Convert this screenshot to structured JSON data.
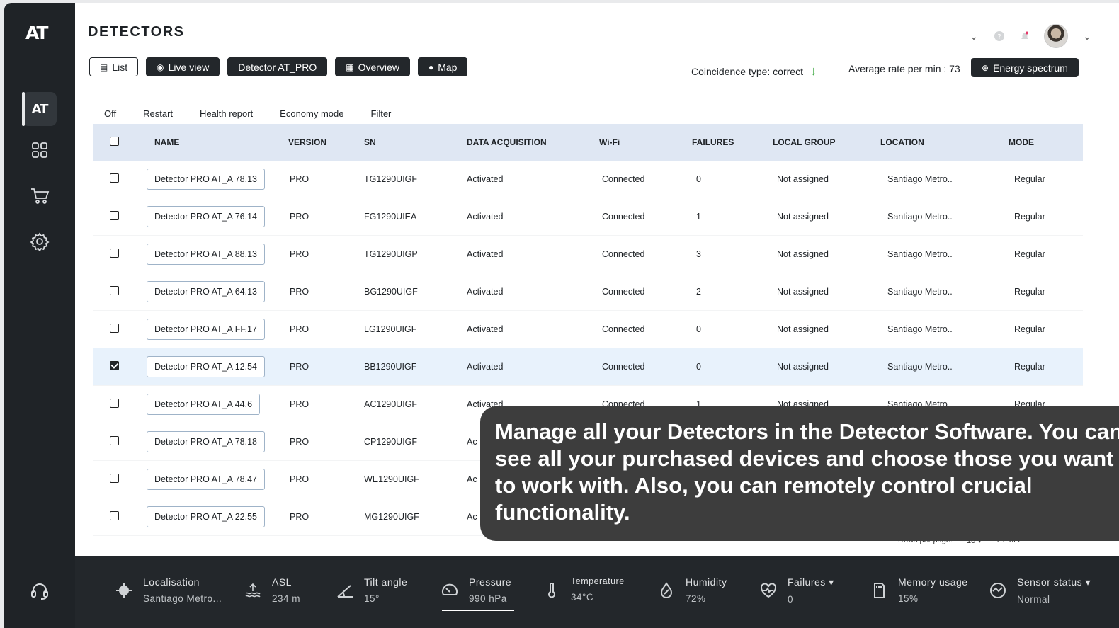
{
  "app": {
    "logo": "AT",
    "title": "DETECTORS"
  },
  "sidebar": {
    "items": [
      {
        "name": "home",
        "icon": "at-logo-icon"
      },
      {
        "name": "dashboard",
        "icon": "grid-icon"
      },
      {
        "name": "shop",
        "icon": "cart-icon"
      },
      {
        "name": "settings",
        "icon": "gear-icon"
      },
      {
        "name": "support",
        "icon": "headset-icon"
      }
    ]
  },
  "toolbar": {
    "list": "List",
    "live_view": "Live view",
    "detector": "Detector AT_PRO",
    "overview": "Overview",
    "map": "Map"
  },
  "header": {
    "coincidence": "Coincidence type: correct",
    "average_rate": "Average rate per min : 73",
    "energy_spectrum": "Energy spectrum"
  },
  "actions": [
    "Off",
    "Restart",
    "Health report",
    "Economy mode",
    "Filter"
  ],
  "table": {
    "columns": [
      "NAME",
      "VERSION",
      "SN",
      "DATA ACQUISITION",
      "Wi-Fi",
      "FAILURES",
      "LOCAL GROUP",
      "LOCATION",
      "MODE"
    ],
    "rows": [
      {
        "checked": false,
        "name": "Detector PRO AT_A 78.13",
        "version": "PRO",
        "sn": "TG1290UIGF",
        "da": "Activated",
        "wifi": "Connected",
        "failures": "0",
        "group": "Not assigned",
        "location": "Santiago Metro..",
        "mode": "Regular"
      },
      {
        "checked": false,
        "name": "Detector PRO AT_A 76.14",
        "version": "PRO",
        "sn": "FG1290UIEA",
        "da": "Activated",
        "wifi": "Connected",
        "failures": "1",
        "group": "Not assigned",
        "location": "Santiago Metro..",
        "mode": "Regular"
      },
      {
        "checked": false,
        "name": "Detector PRO AT_A 88.13",
        "version": "PRO",
        "sn": "TG1290UIGP",
        "da": "Activated",
        "wifi": "Connected",
        "failures": "3",
        "group": "Not assigned",
        "location": "Santiago Metro..",
        "mode": "Regular"
      },
      {
        "checked": false,
        "name": "Detector PRO AT_A 64.13",
        "version": "PRO",
        "sn": "BG1290UIGF",
        "da": "Activated",
        "wifi": "Connected",
        "failures": "2",
        "group": "Not assigned",
        "location": "Santiago Metro..",
        "mode": "Regular"
      },
      {
        "checked": false,
        "name": "Detector PRO AT_A FF.17",
        "version": "PRO",
        "sn": "LG1290UIGF",
        "da": "Activated",
        "wifi": "Connected",
        "failures": "0",
        "group": "Not assigned",
        "location": "Santiago Metro..",
        "mode": "Regular"
      },
      {
        "checked": true,
        "name": "Detector PRO AT_A 12.54",
        "version": "PRO",
        "sn": "BB1290UIGF",
        "da": "Activated",
        "wifi": "Connected",
        "failures": "0",
        "group": "Not assigned",
        "location": "Santiago Metro..",
        "mode": "Regular"
      },
      {
        "checked": false,
        "name": "Detector PRO AT_A 44.6",
        "version": "PRO",
        "sn": "AC1290UIGF",
        "da": "Activated",
        "wifi": "Connected",
        "failures": "1",
        "group": "Not assigned",
        "location": "Santiago Metro..",
        "mode": "Regular"
      },
      {
        "checked": false,
        "name": "Detector PRO AT_A 78.18",
        "version": "PRO",
        "sn": "CP1290UIGF",
        "da": "Ac",
        "wifi": "",
        "failures": "",
        "group": "",
        "location": "",
        "mode": ""
      },
      {
        "checked": false,
        "name": "Detector PRO AT_A 78.47",
        "version": "PRO",
        "sn": "WE1290UIGF",
        "da": "Ac",
        "wifi": "",
        "failures": "",
        "group": "",
        "location": "",
        "mode": ""
      },
      {
        "checked": false,
        "name": "Detector PRO AT_A 22.55",
        "version": "PRO",
        "sn": "MG1290UIGF",
        "da": "Ac",
        "wifi": "",
        "failures": "",
        "group": "",
        "location": "",
        "mode": ""
      }
    ]
  },
  "pager": {
    "rows_label": "Rows per page:",
    "rows_value": "10",
    "range": "1-2 of 2"
  },
  "bottom": {
    "stats": [
      {
        "label": "Localisation",
        "value": "Santiago Metro...",
        "icon": "location-target-icon"
      },
      {
        "label": "ASL",
        "value": "234 m",
        "icon": "altitude-icon"
      },
      {
        "label": "Tilt angle",
        "value": "15°",
        "icon": "angle-icon"
      },
      {
        "label": "Pressure",
        "value": "990 hPa",
        "icon": "gauge-icon"
      },
      {
        "label": "Temperature",
        "value": "34°C",
        "icon": "thermometer-icon"
      },
      {
        "label": "Humidity",
        "value": "72%",
        "icon": "droplet-icon"
      },
      {
        "label": "Failures ▾",
        "value": "0",
        "icon": "heart-pulse-icon"
      },
      {
        "label": "Memory usage",
        "value": "15%",
        "icon": "sd-card-icon"
      },
      {
        "label": "Sensor status ▾",
        "value": "Normal",
        "icon": "status-icon"
      }
    ]
  },
  "tooltip": {
    "text": "Manage all your Detectors in the Detector Software. You can\nsee all your purchased devices and choose those you want\nto work with. Also, you can remotely control crucial\nfunctionality."
  }
}
